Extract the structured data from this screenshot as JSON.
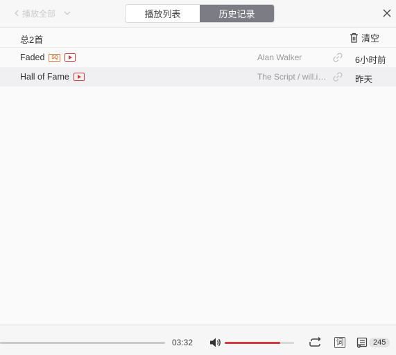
{
  "header": {
    "faded_left_text": "播放全部",
    "tabs": [
      {
        "label": "播放列表",
        "active": false
      },
      {
        "label": "历史记录",
        "active": true
      }
    ]
  },
  "summary": {
    "count_label": "总2首",
    "clear_label": "清空"
  },
  "songs": [
    {
      "title": "Faded",
      "badges": [
        "sq-badge",
        "mv-badge"
      ],
      "artist": "Alan Walker",
      "time": "6小时前"
    },
    {
      "title": "Hall of Fame",
      "badges": [
        "mv-badge"
      ],
      "artist": "The Script / will.i.am",
      "time": "昨天"
    }
  ],
  "player": {
    "elapsed": "03:32",
    "volume_percent": 80,
    "lyric_label": "词",
    "playlist_count": "245",
    "colors": {
      "accent": "#d33a3a",
      "tab_active": "#7c7c84"
    }
  },
  "badge_text": {
    "sq": "SQ"
  }
}
